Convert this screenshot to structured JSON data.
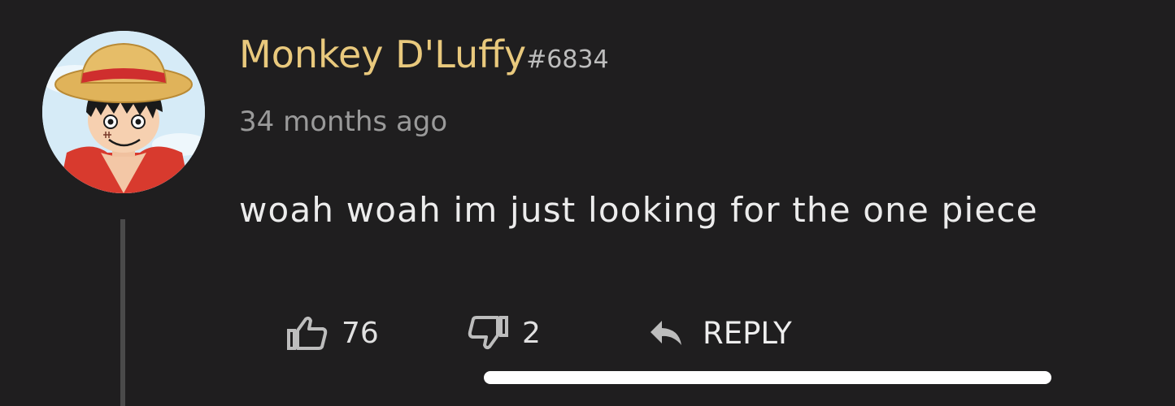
{
  "comment": {
    "author": {
      "username": "Monkey D'Luffy",
      "discriminator": "#6834",
      "avatar_icon": "straw-hat-avatar"
    },
    "timestamp": "34 months ago",
    "text": "woah woah im just looking for the one piece",
    "likes": "76",
    "dislikes": "2",
    "reply_label": "REPLY"
  },
  "colors": {
    "background": "#1f1e1f",
    "username": "#e9c97d",
    "timestamp": "#9a9a9a",
    "text": "#ececec",
    "thread_line": "#4a4a4a"
  },
  "icons": {
    "like": "thumbs-up-icon",
    "dislike": "thumbs-down-icon",
    "reply": "reply-arrow-icon"
  }
}
